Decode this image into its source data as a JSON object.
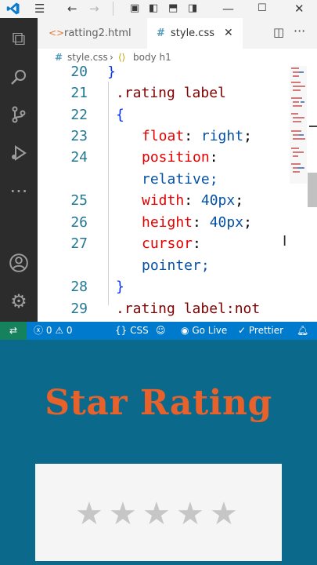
{
  "tabs": [
    {
      "label": "ratting2.html",
      "active": false
    },
    {
      "label": "style.css",
      "active": true
    }
  ],
  "breadcrumb": {
    "file": "style.css",
    "symbol": "body h1"
  },
  "editor": {
    "lines": [
      {
        "num": "20",
        "code": "}",
        "type": "brace"
      },
      {
        "num": "21",
        "code": ".rating label",
        "type": "sel"
      },
      {
        "num": "22",
        "code": "{",
        "type": "brace"
      },
      {
        "num": "23",
        "prop": "float",
        "value": "right"
      },
      {
        "num": "24",
        "prop": "position",
        "value": ""
      },
      {
        "num": "",
        "wrap": "relative;"
      },
      {
        "num": "25",
        "prop": "width",
        "value": "40px"
      },
      {
        "num": "26",
        "prop": "height",
        "value": "40px"
      },
      {
        "num": "27",
        "prop": "cursor",
        "value": ""
      },
      {
        "num": "",
        "wrap": "pointer;"
      },
      {
        "num": "28",
        "code": "}",
        "type": "brace"
      },
      {
        "num": "29",
        "code": ".rating label:not",
        "type": "sel"
      }
    ]
  },
  "statusbar": {
    "errors": "0",
    "warnings": "0",
    "language": "CSS",
    "golive": "Go Live",
    "prettier": "Prettier"
  },
  "preview": {
    "heading": "Star Rating",
    "stars": [
      "★",
      "★",
      "★",
      "★",
      "★"
    ],
    "star_count_total": 5,
    "star_color": "#c6c6c6",
    "heading_color": "#e8612a",
    "background": "#0b6a8c"
  },
  "colors": {
    "accent": "#007acc",
    "remote": "#16825d"
  }
}
